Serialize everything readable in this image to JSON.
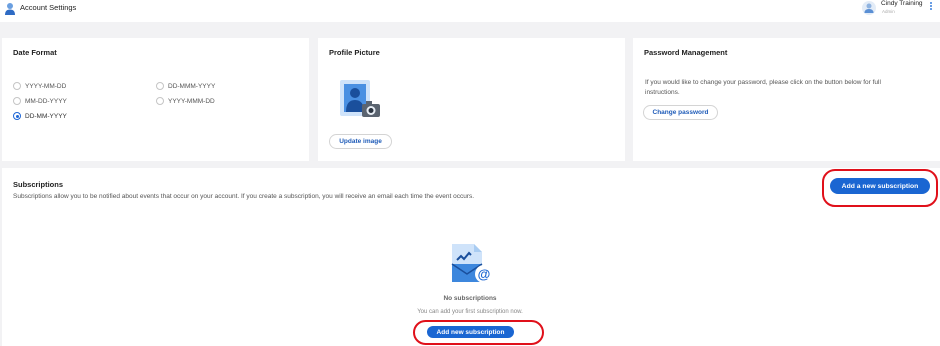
{
  "header": {
    "title": "Account Settings",
    "user_name": "Cindy Training",
    "user_role": "Admin"
  },
  "date_format": {
    "title": "Date Format",
    "options": [
      {
        "label": "YYYY-MM-DD",
        "checked": false
      },
      {
        "label": "DD-MMM-YYYY",
        "checked": false
      },
      {
        "label": "MM-DD-YYYY",
        "checked": false
      },
      {
        "label": "YYYY-MMM-DD",
        "checked": false
      },
      {
        "label": "DD-MM-YYYY",
        "checked": true
      }
    ]
  },
  "profile_picture": {
    "title": "Profile Picture",
    "update_label": "Update image"
  },
  "password": {
    "title": "Password Management",
    "description": "If you would like to change your password, please click on the button below for full instructions.",
    "change_label": "Change password"
  },
  "subscriptions": {
    "title": "Subscriptions",
    "description": "Subscriptions allow you to be notified about events that occur on your account. If you create a subscription, you will receive an email each time the event occurs.",
    "add_label": "Add a new subscription",
    "empty_title": "No subscriptions",
    "empty_subtitle": "You can add your first subscription now.",
    "add_first_label": "Add new subscription"
  },
  "colors": {
    "accent": "#1a66d2",
    "highlight": "#e0101a"
  }
}
